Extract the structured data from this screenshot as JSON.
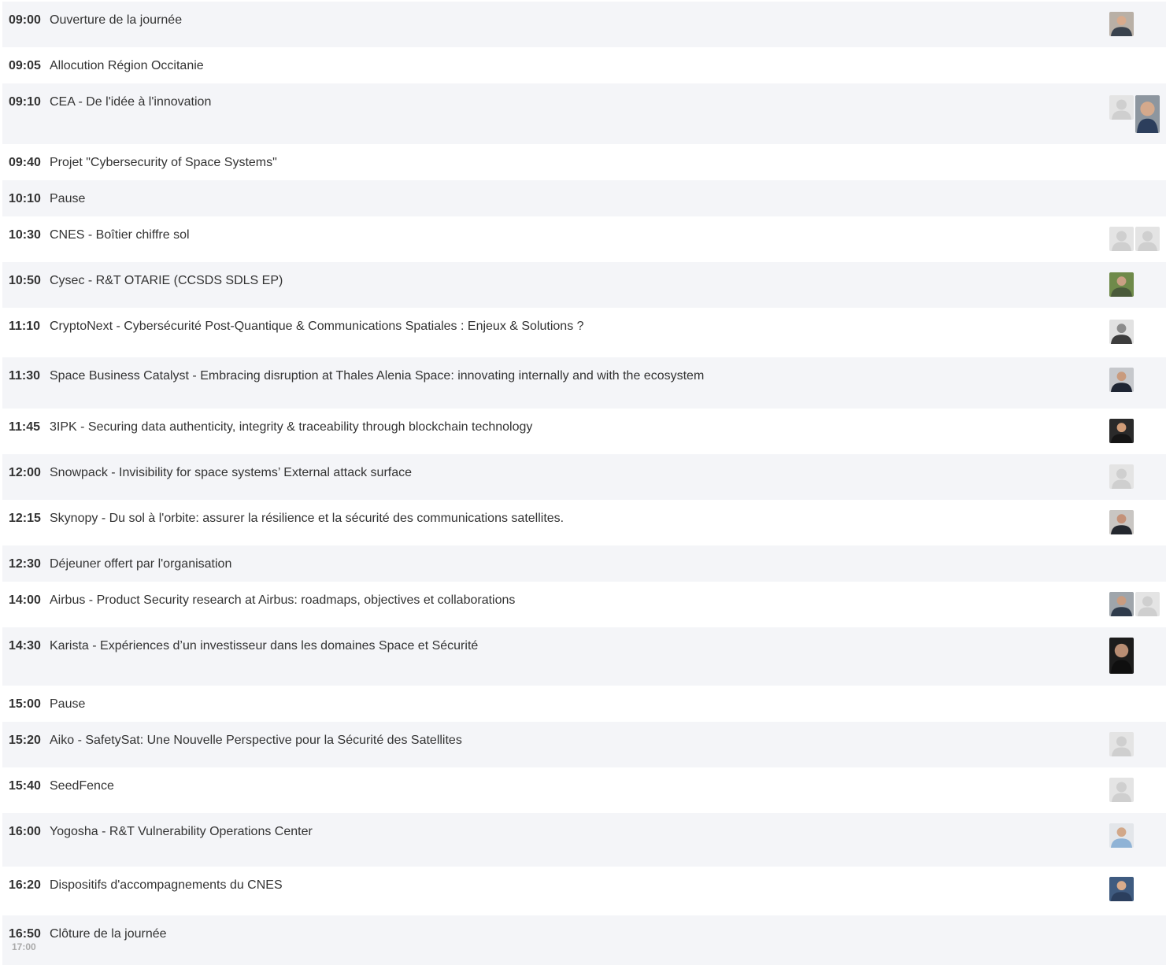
{
  "agenda": {
    "items": [
      {
        "time": "09:00",
        "title": "Ouverture de la journée",
        "speakers": [
          {
            "type": "photo",
            "bg": "#b9b0a6",
            "skin": "#d8ab8d",
            "shirt": "#39424d"
          }
        ]
      },
      {
        "time": "09:05",
        "title": "Allocution Région Occitanie",
        "speakers": []
      },
      {
        "time": "09:10",
        "title": "CEA - De l'idée à l'innovation",
        "speakers": [
          {
            "type": "placeholder"
          },
          {
            "type": "photo",
            "bg": "#8d969f",
            "skin": "#d4a98c",
            "shirt": "#2c3e5c"
          }
        ]
      },
      {
        "time": "09:40",
        "title": "Projet \"Cybersecurity of Space Systems\"",
        "speakers": []
      },
      {
        "time": "10:10",
        "title": "Pause",
        "speakers": []
      },
      {
        "time": "10:30",
        "title": "CNES - Boîtier chiffre sol",
        "speakers": [
          {
            "type": "placeholder"
          },
          {
            "type": "placeholder"
          }
        ]
      },
      {
        "time": "10:50",
        "title": "Cysec - R&T OTARIE (CCSDS SDLS EP)",
        "speakers": [
          {
            "type": "photo",
            "bg": "#6f8a4a",
            "skin": "#caa083",
            "shirt": "#4a5a3a"
          }
        ]
      },
      {
        "time": "11:10",
        "title": "CryptoNext - Cybersécurité Post-Quantique & Communications Spatiales : Enjeux & Solutions ?",
        "speakers": [
          {
            "type": "photo",
            "bg": "#e2e2e2",
            "skin": "#8c8c8c",
            "shirt": "#3d3d3d"
          }
        ]
      },
      {
        "time": "11:30",
        "title": "Space Business Catalyst - Embracing disruption at Thales Alenia Space: innovating internally and with the ecosystem",
        "speakers": [
          {
            "type": "photo",
            "bg": "#c6c8cc",
            "skin": "#c99b7e",
            "shirt": "#1e2533"
          }
        ]
      },
      {
        "time": "11:45",
        "title": "3IPK - Securing data authenticity, integrity & traceability through blockchain technology",
        "speakers": [
          {
            "type": "photo",
            "bg": "#2a2a2a",
            "skin": "#d19d78",
            "shirt": "#151515"
          }
        ]
      },
      {
        "time": "12:00",
        "title": "Snowpack - Invisibility for space systems’ External attack surface",
        "speakers": [
          {
            "type": "placeholder"
          }
        ]
      },
      {
        "time": "12:15",
        "title": "Skynopy - Du sol à l'orbite: assurer la résilience et la sécurité des communications satellites.",
        "speakers": [
          {
            "type": "photo",
            "bg": "#c9c6c3",
            "skin": "#c49178",
            "shirt": "#23272e"
          }
        ]
      },
      {
        "time": "12:30",
        "title": "Déjeuner offert par l'organisation",
        "speakers": []
      },
      {
        "time": "14:00",
        "title": "Airbus - Product Security research at Airbus: roadmaps, objectives et collaborations",
        "speakers": [
          {
            "type": "photo",
            "bg": "#9fa5ab",
            "skin": "#c99c80",
            "shirt": "#2f3b4b"
          },
          {
            "type": "placeholder"
          }
        ]
      },
      {
        "time": "14:30",
        "title": "Karista - Expériences d’un investisseur dans les domaines Space et Sécurité",
        "speakers": [
          {
            "type": "photo",
            "bg": "#1c1c1c",
            "skin": "#b88d73",
            "shirt": "#0f0f0f"
          }
        ]
      },
      {
        "time": "15:00",
        "title": "Pause",
        "speakers": []
      },
      {
        "time": "15:20",
        "title": "Aiko - SafetySat: Une Nouvelle Perspective pour la Sécurité des Satellites",
        "speakers": [
          {
            "type": "placeholder"
          }
        ]
      },
      {
        "time": "15:40",
        "title": "SeedFence",
        "speakers": [
          {
            "type": "placeholder"
          }
        ]
      },
      {
        "time": "16:00",
        "title": "Yogosha - R&T Vulnerability Operations Center",
        "speakers": [
          {
            "type": "photo",
            "bg": "#e3e6ea",
            "skin": "#d2a889",
            "shirt": "#8fb3d6"
          }
        ]
      },
      {
        "time": "16:20",
        "title": "Dispositifs d'accompagnements du CNES",
        "speakers": [
          {
            "type": "photo",
            "bg": "#3f5b80",
            "skin": "#d9ab8b",
            "shirt": "#2b3f5e"
          }
        ]
      },
      {
        "time": "16:50",
        "title": "Clôture de la journée",
        "end_time": "17:00",
        "speakers": []
      }
    ]
  }
}
